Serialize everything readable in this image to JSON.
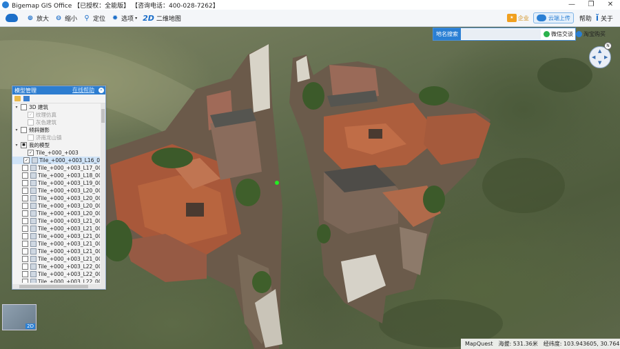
{
  "titlebar": {
    "title": "Bigemap GIS Office 【已授权：全能版】 【咨询电话：400-028-7262】",
    "minimize": "—",
    "restore": "❐",
    "close": "✕"
  },
  "toolbar": {
    "zoom_in": "放大",
    "zoom_out": "缩小",
    "locate": "定位",
    "options": "选项",
    "map2d_icon": "2D",
    "map2d": "二维地图",
    "enterprise": "企业",
    "upload": "云端上传",
    "help": "帮助",
    "about": "关于"
  },
  "search": {
    "label": "地名搜索",
    "value": "",
    "wechat": "微信交谈",
    "taobao": "淘宝购买"
  },
  "compass": {
    "north": "N"
  },
  "panel": {
    "title": "模型管理",
    "link": "在线帮助",
    "collapse": "«",
    "tree": [
      {
        "label": "3D 建筑",
        "level": 0,
        "expander": "▾",
        "checked": false,
        "dim": false
      },
      {
        "label": "纹理仿真",
        "level": 1,
        "checked": true,
        "dim": true
      },
      {
        "label": "灰色建筑",
        "level": 1,
        "checked": false,
        "dim": true
      },
      {
        "label": "倾斜摄影",
        "level": 0,
        "expander": "▾",
        "checked": false,
        "dim": false
      },
      {
        "label": "济南龙山镇",
        "level": 1,
        "checked": false,
        "dim": true
      },
      {
        "label": "我的模型",
        "level": 0,
        "expander": "▾",
        "checked": "partial",
        "dim": false
      },
      {
        "label": "Tile_+000_+003",
        "level": 1,
        "checked": true,
        "dim": false,
        "tile": false
      },
      {
        "label": "Tile_+000_+003_L16_0",
        "level": 1,
        "checked": true,
        "dim": false,
        "tile": true,
        "selected": true
      },
      {
        "label": "Tile_+000_+003_L17_00",
        "level": 1,
        "checked": false,
        "dim": false,
        "tile": true
      },
      {
        "label": "Tile_+000_+003_L18_00",
        "level": 1,
        "checked": false,
        "dim": false,
        "tile": true
      },
      {
        "label": "Tile_+000_+003_L19_00",
        "level": 1,
        "checked": false,
        "dim": false,
        "tile": true
      },
      {
        "label": "Tile_+000_+003_L20_00",
        "level": 1,
        "checked": false,
        "dim": false,
        "tile": true
      },
      {
        "label": "Tile_+000_+003_L20_00",
        "level": 1,
        "checked": false,
        "dim": false,
        "tile": true
      },
      {
        "label": "Tile_+000_+003_L20_00",
        "level": 1,
        "checked": false,
        "dim": false,
        "tile": true
      },
      {
        "label": "Tile_+000_+003_L20_00",
        "level": 1,
        "checked": false,
        "dim": false,
        "tile": true
      },
      {
        "label": "Tile_+000_+003_L21_00",
        "level": 1,
        "checked": false,
        "dim": false,
        "tile": true
      },
      {
        "label": "Tile_+000_+003_L21_00",
        "level": 1,
        "checked": false,
        "dim": false,
        "tile": true
      },
      {
        "label": "Tile_+000_+003_L21_00",
        "level": 1,
        "checked": false,
        "dim": false,
        "tile": true
      },
      {
        "label": "Tile_+000_+003_L21_00",
        "level": 1,
        "checked": false,
        "dim": false,
        "tile": true
      },
      {
        "label": "Tile_+000_+003_L21_00",
        "level": 1,
        "checked": false,
        "dim": false,
        "tile": true
      },
      {
        "label": "Tile_+000_+003_L21_00",
        "level": 1,
        "checked": false,
        "dim": false,
        "tile": true
      },
      {
        "label": "Tile_+000_+003_L22_00",
        "level": 1,
        "checked": false,
        "dim": false,
        "tile": true
      },
      {
        "label": "Tile_+000_+003_L22_00",
        "level": 1,
        "checked": false,
        "dim": false,
        "tile": true
      },
      {
        "label": "Tile_+000_+003_L22_00",
        "level": 1,
        "checked": false,
        "dim": false,
        "tile": true
      }
    ]
  },
  "minimap": {
    "tag": "2D"
  },
  "status": {
    "provider": "MapQuest",
    "altitude": "海拔: 531.36米",
    "coords": "经纬度: 103.943605, 30.764858"
  }
}
